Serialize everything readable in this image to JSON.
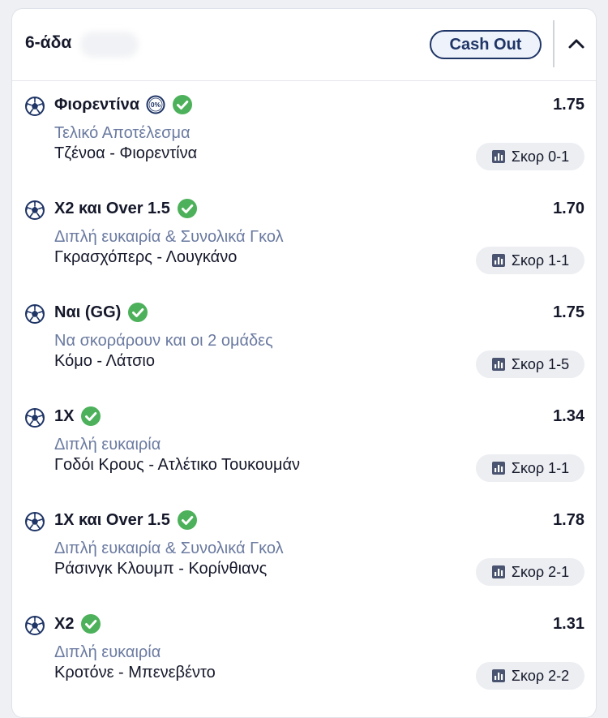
{
  "header": {
    "title": "6-άδα",
    "cashout_label": "Cash Out",
    "collapse_icon": "chevron-up-icon"
  },
  "colors": {
    "accent": "#1f3566",
    "check": "#4cb15a",
    "market_text": "#6a7aa0",
    "score_chip_bg": "#eceef2"
  },
  "selections": [
    {
      "pick": "Φιορεντίνα",
      "zero_margin": true,
      "odds": "1.75",
      "market": "Τελικό Αποτέλεσμα",
      "match": "Τζένοα - Φιορεντίνα",
      "score": "Σκορ 0-1"
    },
    {
      "pick": "Χ2 και Over 1.5",
      "zero_margin": false,
      "odds": "1.70",
      "market": "Διπλή ευκαιρία & Συνολικά Γκολ",
      "match": "Γκρασχόπερς - Λουγκάνο",
      "score": "Σκορ 1-1"
    },
    {
      "pick": "Ναι (GG)",
      "zero_margin": false,
      "odds": "1.75",
      "market": "Να σκοράρουν και οι 2 ομάδες",
      "match": "Κόμο - Λάτσιο",
      "score": "Σκορ 1-5"
    },
    {
      "pick": "1Χ",
      "zero_margin": false,
      "odds": "1.34",
      "market": "Διπλή ευκαιρία",
      "match": "Γοδόι Κρους - Ατλέτικο Τουκουμάν",
      "score": "Σκορ 1-1"
    },
    {
      "pick": "1Χ και Over 1.5",
      "zero_margin": false,
      "odds": "1.78",
      "market": "Διπλή ευκαιρία & Συνολικά Γκολ",
      "match": "Ράσινγκ Κλουμπ - Κορίνθιανς",
      "score": "Σκορ 2-1"
    },
    {
      "pick": "Χ2",
      "zero_margin": false,
      "odds": "1.31",
      "market": "Διπλή ευκαιρία",
      "match": "Κροτόνε - Μπενεβέντο",
      "score": "Σκορ 2-2"
    }
  ],
  "zero_margin_badge": "0%"
}
